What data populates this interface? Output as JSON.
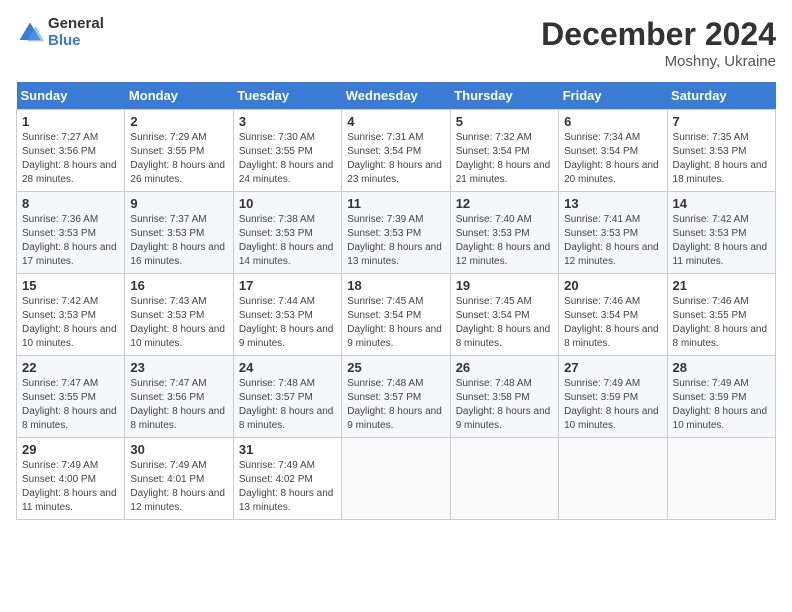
{
  "logo": {
    "general": "General",
    "blue": "Blue"
  },
  "header": {
    "month": "December 2024",
    "location": "Moshny, Ukraine"
  },
  "weekdays": [
    "Sunday",
    "Monday",
    "Tuesday",
    "Wednesday",
    "Thursday",
    "Friday",
    "Saturday"
  ],
  "weeks": [
    [
      {
        "day": "1",
        "sunrise": "7:27 AM",
        "sunset": "3:56 PM",
        "daylight": "8 hours and 28 minutes."
      },
      {
        "day": "2",
        "sunrise": "7:29 AM",
        "sunset": "3:55 PM",
        "daylight": "8 hours and 26 minutes."
      },
      {
        "day": "3",
        "sunrise": "7:30 AM",
        "sunset": "3:55 PM",
        "daylight": "8 hours and 24 minutes."
      },
      {
        "day": "4",
        "sunrise": "7:31 AM",
        "sunset": "3:54 PM",
        "daylight": "8 hours and 23 minutes."
      },
      {
        "day": "5",
        "sunrise": "7:32 AM",
        "sunset": "3:54 PM",
        "daylight": "8 hours and 21 minutes."
      },
      {
        "day": "6",
        "sunrise": "7:34 AM",
        "sunset": "3:54 PM",
        "daylight": "8 hours and 20 minutes."
      },
      {
        "day": "7",
        "sunrise": "7:35 AM",
        "sunset": "3:53 PM",
        "daylight": "8 hours and 18 minutes."
      }
    ],
    [
      {
        "day": "8",
        "sunrise": "7:36 AM",
        "sunset": "3:53 PM",
        "daylight": "8 hours and 17 minutes."
      },
      {
        "day": "9",
        "sunrise": "7:37 AM",
        "sunset": "3:53 PM",
        "daylight": "8 hours and 16 minutes."
      },
      {
        "day": "10",
        "sunrise": "7:38 AM",
        "sunset": "3:53 PM",
        "daylight": "8 hours and 14 minutes."
      },
      {
        "day": "11",
        "sunrise": "7:39 AM",
        "sunset": "3:53 PM",
        "daylight": "8 hours and 13 minutes."
      },
      {
        "day": "12",
        "sunrise": "7:40 AM",
        "sunset": "3:53 PM",
        "daylight": "8 hours and 12 minutes."
      },
      {
        "day": "13",
        "sunrise": "7:41 AM",
        "sunset": "3:53 PM",
        "daylight": "8 hours and 12 minutes."
      },
      {
        "day": "14",
        "sunrise": "7:42 AM",
        "sunset": "3:53 PM",
        "daylight": "8 hours and 11 minutes."
      }
    ],
    [
      {
        "day": "15",
        "sunrise": "7:42 AM",
        "sunset": "3:53 PM",
        "daylight": "8 hours and 10 minutes."
      },
      {
        "day": "16",
        "sunrise": "7:43 AM",
        "sunset": "3:53 PM",
        "daylight": "8 hours and 10 minutes."
      },
      {
        "day": "17",
        "sunrise": "7:44 AM",
        "sunset": "3:53 PM",
        "daylight": "8 hours and 9 minutes."
      },
      {
        "day": "18",
        "sunrise": "7:45 AM",
        "sunset": "3:54 PM",
        "daylight": "8 hours and 9 minutes."
      },
      {
        "day": "19",
        "sunrise": "7:45 AM",
        "sunset": "3:54 PM",
        "daylight": "8 hours and 8 minutes."
      },
      {
        "day": "20",
        "sunrise": "7:46 AM",
        "sunset": "3:54 PM",
        "daylight": "8 hours and 8 minutes."
      },
      {
        "day": "21",
        "sunrise": "7:46 AM",
        "sunset": "3:55 PM",
        "daylight": "8 hours and 8 minutes."
      }
    ],
    [
      {
        "day": "22",
        "sunrise": "7:47 AM",
        "sunset": "3:55 PM",
        "daylight": "8 hours and 8 minutes."
      },
      {
        "day": "23",
        "sunrise": "7:47 AM",
        "sunset": "3:56 PM",
        "daylight": "8 hours and 8 minutes."
      },
      {
        "day": "24",
        "sunrise": "7:48 AM",
        "sunset": "3:57 PM",
        "daylight": "8 hours and 8 minutes."
      },
      {
        "day": "25",
        "sunrise": "7:48 AM",
        "sunset": "3:57 PM",
        "daylight": "8 hours and 9 minutes."
      },
      {
        "day": "26",
        "sunrise": "7:48 AM",
        "sunset": "3:58 PM",
        "daylight": "8 hours and 9 minutes."
      },
      {
        "day": "27",
        "sunrise": "7:49 AM",
        "sunset": "3:59 PM",
        "daylight": "8 hours and 10 minutes."
      },
      {
        "day": "28",
        "sunrise": "7:49 AM",
        "sunset": "3:59 PM",
        "daylight": "8 hours and 10 minutes."
      }
    ],
    [
      {
        "day": "29",
        "sunrise": "7:49 AM",
        "sunset": "4:00 PM",
        "daylight": "8 hours and 11 minutes."
      },
      {
        "day": "30",
        "sunrise": "7:49 AM",
        "sunset": "4:01 PM",
        "daylight": "8 hours and 12 minutes."
      },
      {
        "day": "31",
        "sunrise": "7:49 AM",
        "sunset": "4:02 PM",
        "daylight": "8 hours and 13 minutes."
      },
      null,
      null,
      null,
      null
    ]
  ],
  "labels": {
    "sunrise": "Sunrise:",
    "sunset": "Sunset:",
    "daylight": "Daylight:"
  }
}
